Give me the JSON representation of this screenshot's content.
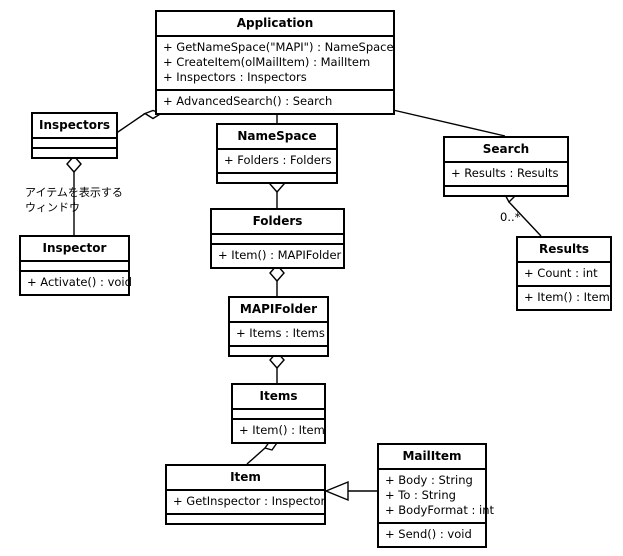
{
  "diagram": {
    "title": "Outlook Object Model UML Class Diagram",
    "background_color": "#ffffff",
    "line_color": "#000000",
    "classes": [
      {
        "id": "application",
        "name": "Application",
        "attributes": [
          "+ GetNameSpace(\"MAPI\") : NameSpace",
          "+ CreateItem(olMailItem) : MailItem",
          "+ Inspectors : Inspectors"
        ],
        "operations": [
          "+ AdvancedSearch() : Search"
        ]
      },
      {
        "id": "inspectors",
        "name": "Inspectors",
        "attributes": [],
        "operations": []
      },
      {
        "id": "inspector",
        "name": "Inspector",
        "attributes": [],
        "operations": [
          "+ Activate() : void"
        ]
      },
      {
        "id": "namespace",
        "name": "NameSpace",
        "attributes": [
          "+ Folders : Folders"
        ],
        "operations": []
      },
      {
        "id": "folders",
        "name": "Folders",
        "attributes": [],
        "operations": [
          "+ Item() : MAPIFolder"
        ]
      },
      {
        "id": "mapifolder",
        "name": "MAPIFolder",
        "attributes": [
          "+ Items : Items"
        ],
        "operations": []
      },
      {
        "id": "items",
        "name": "Items",
        "attributes": [],
        "operations": [
          "+ Item() : Item"
        ]
      },
      {
        "id": "item",
        "name": "Item",
        "attributes": [
          "+ GetInspector : Inspector"
        ],
        "operations": []
      },
      {
        "id": "mailitem",
        "name": "MailItem",
        "attributes": [
          "+ Body : String",
          "+ To : String",
          "+ BodyFormat : int"
        ],
        "operations": [
          "+ Send() : void"
        ]
      },
      {
        "id": "search",
        "name": "Search",
        "attributes": [
          "+ Results : Results"
        ],
        "operations": []
      },
      {
        "id": "results",
        "name": "Results",
        "attributes": [
          "+ Count : int"
        ],
        "operations": [
          "+ Item() : Item"
        ]
      }
    ],
    "annotations": {
      "inspector_note_line1": "アイテムを表示する",
      "inspector_note_line2": "ウィンドウ"
    },
    "multiplicities": {
      "search_results": "0..*"
    }
  }
}
